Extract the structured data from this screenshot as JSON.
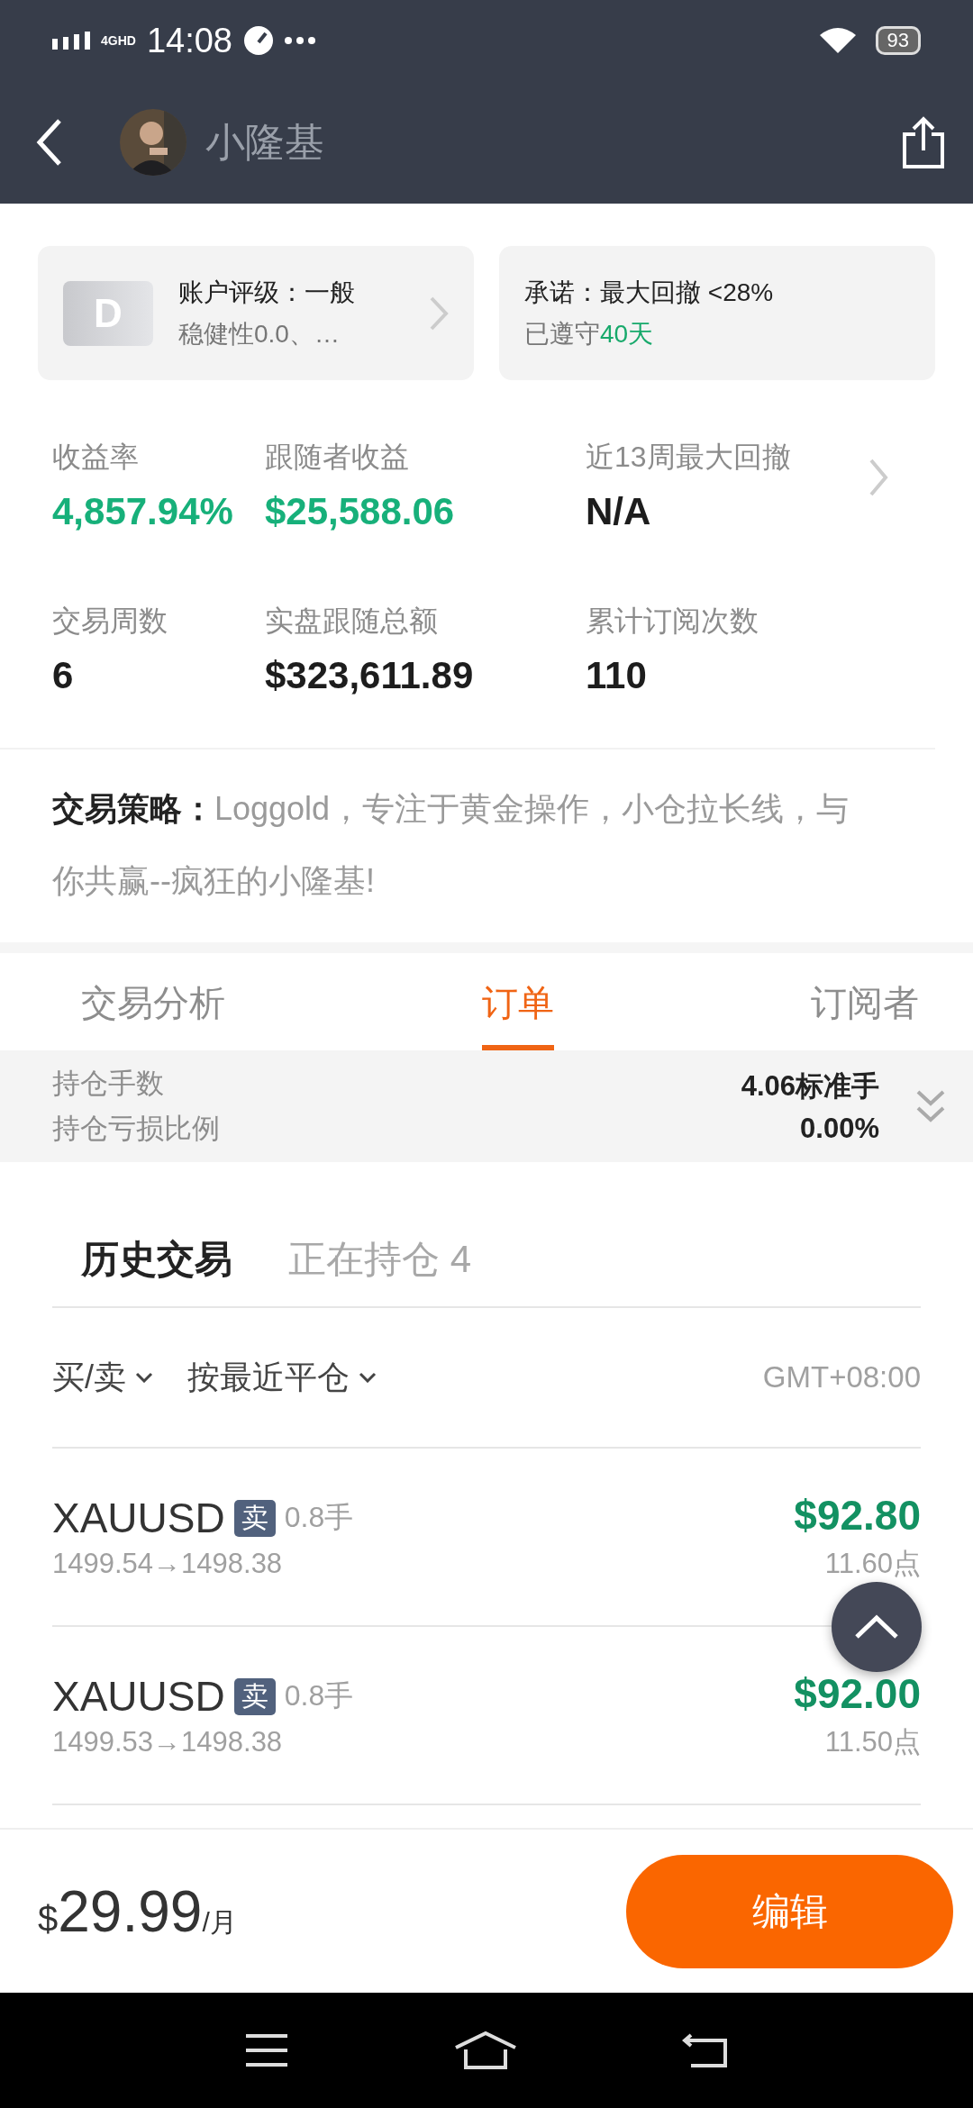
{
  "status_bar": {
    "network": "4GHD",
    "time": "14:08",
    "battery": "93"
  },
  "header": {
    "title": "小隆基"
  },
  "rating_card": {
    "badge": "D",
    "title": "账户评级：一般",
    "subtitle": "稳健性0.0、…"
  },
  "promise_card": {
    "title": "承诺：最大回撤 <28%",
    "subtitle": "已遵守",
    "highlight": "40天"
  },
  "stats": [
    {
      "label": "收益率",
      "value": "4,857.94%",
      "kind": "positive"
    },
    {
      "label": "跟随者收益",
      "value": "$25,588.06",
      "kind": "positive"
    },
    {
      "label": "近13周最大回撤",
      "value": "N/A",
      "kind": "neutral"
    },
    {
      "label": "交易周数",
      "value": "6",
      "kind": "neutral"
    },
    {
      "label": "实盘跟随总额",
      "value": "$323,611.89",
      "kind": "neutral"
    },
    {
      "label": "累计订阅次数",
      "value": "110",
      "kind": "neutral"
    }
  ],
  "strategy": {
    "label": "交易策略：",
    "text": "Loggold，专注于黄金操作，小仓拉长线，与你共赢--疯狂的小隆基!"
  },
  "tabs": [
    {
      "label": "交易分析",
      "selected": false
    },
    {
      "label": "订单",
      "selected": true
    },
    {
      "label": "订阅者",
      "selected": false
    }
  ],
  "summary": [
    {
      "label": "持仓手数",
      "value": "4.06标准手"
    },
    {
      "label": "持仓亏损比例",
      "value": "0.00%"
    }
  ],
  "subtabs": [
    {
      "label": "历史交易",
      "selected": true
    },
    {
      "label": "正在持仓 4",
      "selected": false
    }
  ],
  "filters": [
    {
      "label": "买/卖"
    },
    {
      "label": "按最近平仓"
    }
  ],
  "timezone": "GMT+08:00",
  "trades": [
    {
      "symbol": "XAUUSD",
      "side": "卖",
      "lots": "0.8手",
      "prices": "1499.54→1498.38",
      "profit": "$92.80",
      "points": "11.60点"
    },
    {
      "symbol": "XAUUSD",
      "side": "卖",
      "lots": "0.8手",
      "prices": "1499.53→1498.38",
      "profit": "$92.00",
      "points": "11.50点"
    }
  ],
  "footer": {
    "currency": "$",
    "price": "29.99",
    "unit": "/月",
    "button": "编辑"
  }
}
